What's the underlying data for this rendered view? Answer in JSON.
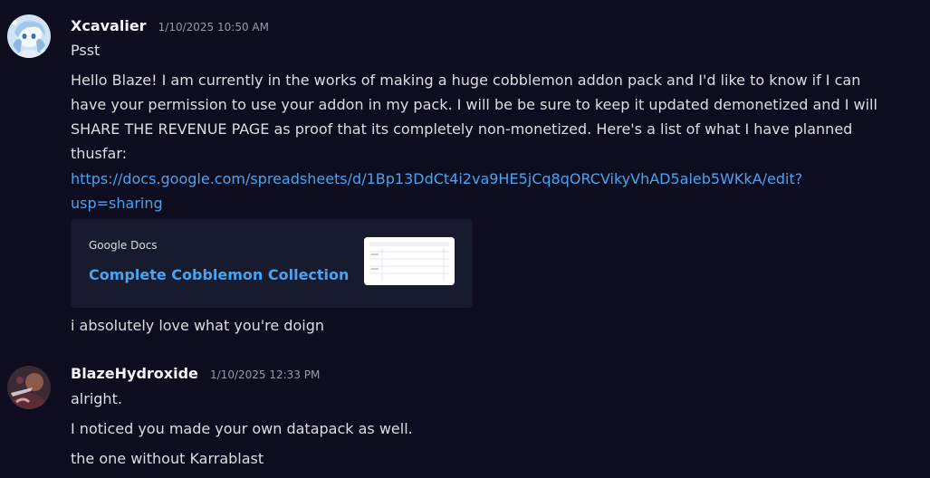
{
  "messages": [
    {
      "username": "Xcavalier",
      "timestamp": "1/10/2025 10:50 AM",
      "avatar_icon": "anime-avatar-icon",
      "lines": {
        "l1": "Psst",
        "l2a": "Hello Blaze! I am currently in the works of making a huge cobblemon addon pack and I'd like to know if I can",
        "l2b": "have your permission to use your addon in my pack. I will be be sure to keep it updated demonetized and I will",
        "l2c": "SHARE THE REVENUE PAGE as proof that its completely non-monetized. Here's a list of what I have planned",
        "l2d": "thusfar:",
        "link_a": "https://docs.google.com/spreadsheets/d/1Bp13DdCt4i2va9HE5jCq8qORCVikyVhAD5aleb5WKkA/edit?",
        "link_b": "usp=sharing",
        "l4": "i absolutely love what you're doign"
      },
      "embed": {
        "provider": "Google Docs",
        "title": "Complete Cobblemon Collection",
        "thumbnail_icon": "spreadsheet-thumbnail-icon"
      }
    },
    {
      "username": "BlazeHydroxide",
      "timestamp": "1/10/2025 12:33 PM",
      "avatar_icon": "user-avatar-icon",
      "lines": {
        "l1": "alright.",
        "l2": "I noticed you made your own datapack as well.",
        "l3": "the one without Karrablast"
      }
    }
  ],
  "colors": {
    "background": "#0d0d1f",
    "link": "#4aa3f0",
    "embed_bg": "#181a2e",
    "username": "#f2f3f5",
    "timestamp": "#949ba4"
  }
}
